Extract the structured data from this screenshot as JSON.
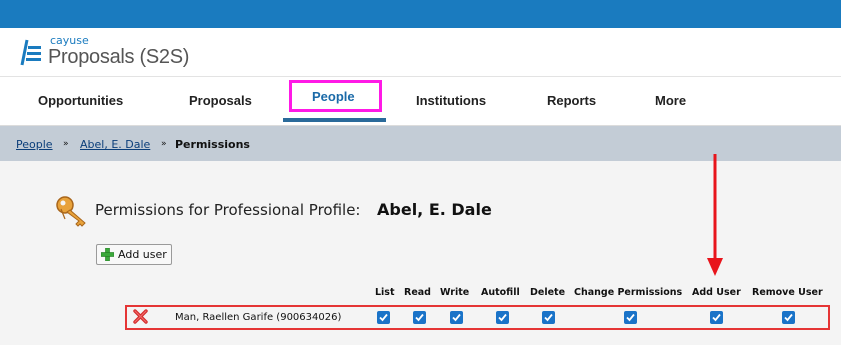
{
  "header": {
    "brand": "cayuse",
    "product": "Proposals (S2S)"
  },
  "nav": {
    "items": [
      {
        "label": "Opportunities"
      },
      {
        "label": "Proposals"
      },
      {
        "label": "People"
      },
      {
        "label": "Institutions"
      },
      {
        "label": "Reports"
      },
      {
        "label": "More"
      }
    ],
    "active": "People"
  },
  "breadcrumb": {
    "items": [
      "People",
      "Abel, E. Dale",
      "Permissions"
    ],
    "separator": "»"
  },
  "permissions": {
    "title": "Permissions for Professional Profile:",
    "profile_name": "Abel, E. Dale",
    "add_user_label": "Add user",
    "columns": [
      "List",
      "Read",
      "Write",
      "Autofill",
      "Delete",
      "Change Permissions",
      "Add User",
      "Remove User"
    ],
    "rows": [
      {
        "user": "Man, Raellen Garife (900634026)",
        "checked": [
          true,
          true,
          true,
          true,
          true,
          true,
          true,
          true
        ]
      }
    ]
  },
  "colors": {
    "topbar": "#1a7bbf",
    "highlight_box": "#ff19e6",
    "row_highlight": "#e53535",
    "arrow": "#e8141b",
    "checkbox": "#1a73c8"
  }
}
